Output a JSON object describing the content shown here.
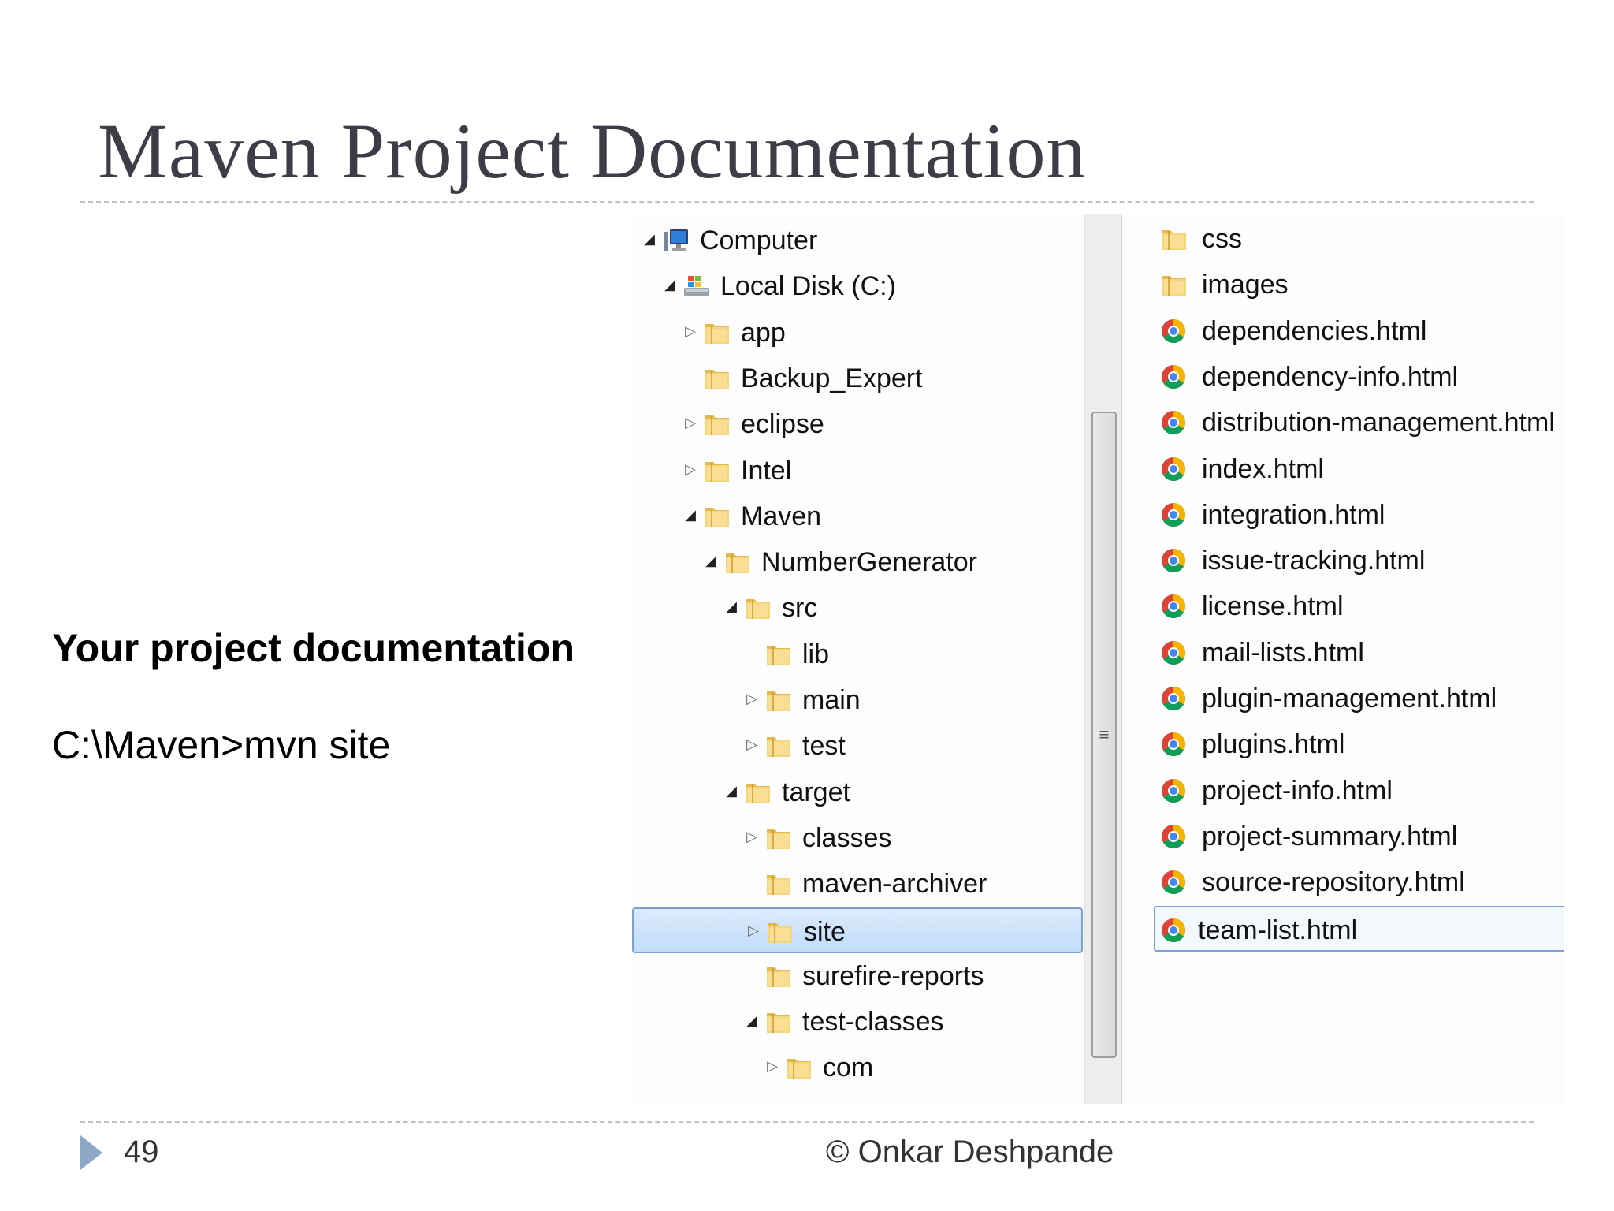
{
  "slide": {
    "title": "Maven Project Documentation",
    "heading": "Your project documentation",
    "command": "C:\\Maven>mvn site",
    "page_number": "49",
    "copyright": "© Onkar Deshpande"
  },
  "colors": {
    "title_text": "#3d3d48",
    "selection_fill": "#cce4fb",
    "selection_border": "#7da2ce",
    "folder": "#f1cf6e",
    "page_marker": "#8fa7c6"
  },
  "tree": {
    "items": [
      {
        "label": "Computer",
        "depth": 0,
        "expander": "expanded",
        "icon": "computer-icon"
      },
      {
        "label": "Local Disk (C:)",
        "depth": 1,
        "expander": "expanded",
        "icon": "drive-icon"
      },
      {
        "label": "app",
        "depth": 2,
        "expander": "collapsed",
        "icon": "folder-icon"
      },
      {
        "label": "Backup_Expert",
        "depth": 2,
        "expander": "none",
        "icon": "folder-icon"
      },
      {
        "label": "eclipse",
        "depth": 2,
        "expander": "collapsed",
        "icon": "folder-icon"
      },
      {
        "label": "Intel",
        "depth": 2,
        "expander": "collapsed",
        "icon": "folder-icon"
      },
      {
        "label": "Maven",
        "depth": 2,
        "expander": "expanded",
        "icon": "folder-icon"
      },
      {
        "label": "NumberGenerator",
        "depth": 3,
        "expander": "expanded",
        "icon": "folder-icon"
      },
      {
        "label": "src",
        "depth": 4,
        "expander": "expanded",
        "icon": "folder-icon"
      },
      {
        "label": "lib",
        "depth": 5,
        "expander": "none",
        "icon": "folder-icon"
      },
      {
        "label": "main",
        "depth": 5,
        "expander": "collapsed",
        "icon": "folder-icon"
      },
      {
        "label": "test",
        "depth": 5,
        "expander": "collapsed",
        "icon": "folder-icon"
      },
      {
        "label": "target",
        "depth": 4,
        "expander": "expanded",
        "icon": "folder-icon"
      },
      {
        "label": "classes",
        "depth": 5,
        "expander": "collapsed",
        "icon": "folder-icon"
      },
      {
        "label": "maven-archiver",
        "depth": 5,
        "expander": "none",
        "icon": "folder-icon"
      },
      {
        "label": "site",
        "depth": 5,
        "expander": "collapsed",
        "icon": "folder-icon",
        "selected": true
      },
      {
        "label": "surefire-reports",
        "depth": 5,
        "expander": "none",
        "icon": "folder-icon"
      },
      {
        "label": "test-classes",
        "depth": 5,
        "expander": "expanded",
        "icon": "folder-icon"
      },
      {
        "label": "com",
        "depth": 6,
        "expander": "collapsed",
        "icon": "folder-icon"
      }
    ]
  },
  "files": {
    "items": [
      {
        "label": "css",
        "icon": "folder-icon"
      },
      {
        "label": "images",
        "icon": "folder-icon"
      },
      {
        "label": "dependencies.html",
        "icon": "chrome-html-icon"
      },
      {
        "label": "dependency-info.html",
        "icon": "chrome-html-icon"
      },
      {
        "label": "distribution-management.html",
        "icon": "chrome-html-icon"
      },
      {
        "label": "index.html",
        "icon": "chrome-html-icon"
      },
      {
        "label": "integration.html",
        "icon": "chrome-html-icon"
      },
      {
        "label": "issue-tracking.html",
        "icon": "chrome-html-icon"
      },
      {
        "label": "license.html",
        "icon": "chrome-html-icon"
      },
      {
        "label": "mail-lists.html",
        "icon": "chrome-html-icon"
      },
      {
        "label": "plugin-management.html",
        "icon": "chrome-html-icon"
      },
      {
        "label": "plugins.html",
        "icon": "chrome-html-icon"
      },
      {
        "label": "project-info.html",
        "icon": "chrome-html-icon"
      },
      {
        "label": "project-summary.html",
        "icon": "chrome-html-icon"
      },
      {
        "label": "source-repository.html",
        "icon": "chrome-html-icon"
      },
      {
        "label": "team-list.html",
        "icon": "chrome-html-icon",
        "selected": true
      }
    ]
  }
}
